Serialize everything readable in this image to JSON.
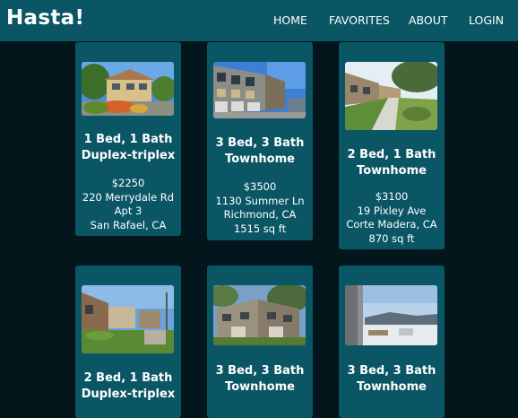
{
  "app": {
    "logo": "Hasta!"
  },
  "nav": {
    "home": "HOME",
    "favorites": "FAVORITES",
    "about": "ABOUT",
    "login": "LOGIN"
  },
  "colors": {
    "background": "#03161c",
    "header": "#0b5665",
    "card": "#0b5665",
    "text": "#ffffff"
  },
  "listings": [
    {
      "title_line1": "1 Bed, 1 Bath",
      "title_line2": "Duplex-triplex",
      "price": "$2250",
      "details": [
        "220 Merrydale Rd",
        "Apt 3",
        "San Rafael, CA"
      ]
    },
    {
      "title_line1": "3 Bed, 3 Bath",
      "title_line2": "Townhome",
      "price": "$3500",
      "details": [
        "1130 Summer Ln",
        "Richmond, CA",
        "1515 sq ft"
      ]
    },
    {
      "title_line1": "2 Bed, 1 Bath",
      "title_line2": "Townhome",
      "price": "$3100",
      "details": [
        "19 Pixley Ave",
        "Corte Madera, CA",
        "870 sq ft"
      ]
    },
    {
      "title_line1": "2 Bed, 1 Bath",
      "title_line2": "Duplex-triplex"
    },
    {
      "title_line1": "3 Bed, 3 Bath",
      "title_line2": "Townhome"
    },
    {
      "title_line1": "3 Bed, 3 Bath",
      "title_line2": "Townhome"
    }
  ]
}
